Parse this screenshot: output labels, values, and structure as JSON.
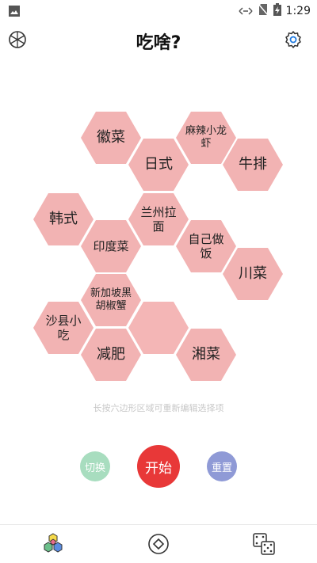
{
  "status_bar": {
    "time": "1:29",
    "icons": [
      "image-icon",
      "signal-icon",
      "no-sim-icon",
      "battery-charging-icon"
    ]
  },
  "header": {
    "title": "吃啥?",
    "left_icon": "wheel-icon",
    "right_icon": "settings-gear-icon"
  },
  "hex_options": [
    "徽菜",
    "麻辣小龙虾",
    "日式",
    "牛排",
    "韩式",
    "兰州拉面",
    "印度菜",
    "自己做饭",
    "川菜",
    "新加坡黑胡椒蟹",
    "沙县小吃",
    "",
    "减肥",
    "湘菜"
  ],
  "hint": "长按六边形区域可重新编辑选择项",
  "buttons": {
    "switch": "切换",
    "start": "开始",
    "reset": "重置"
  },
  "colors": {
    "hex_fill": "#f2b3b3",
    "start": "#e83838",
    "switch": "#a8ddbf",
    "reset": "#8f9ad6"
  },
  "bottom_nav": [
    "hexagons-icon",
    "diamond-circle-icon",
    "dice-icon"
  ]
}
